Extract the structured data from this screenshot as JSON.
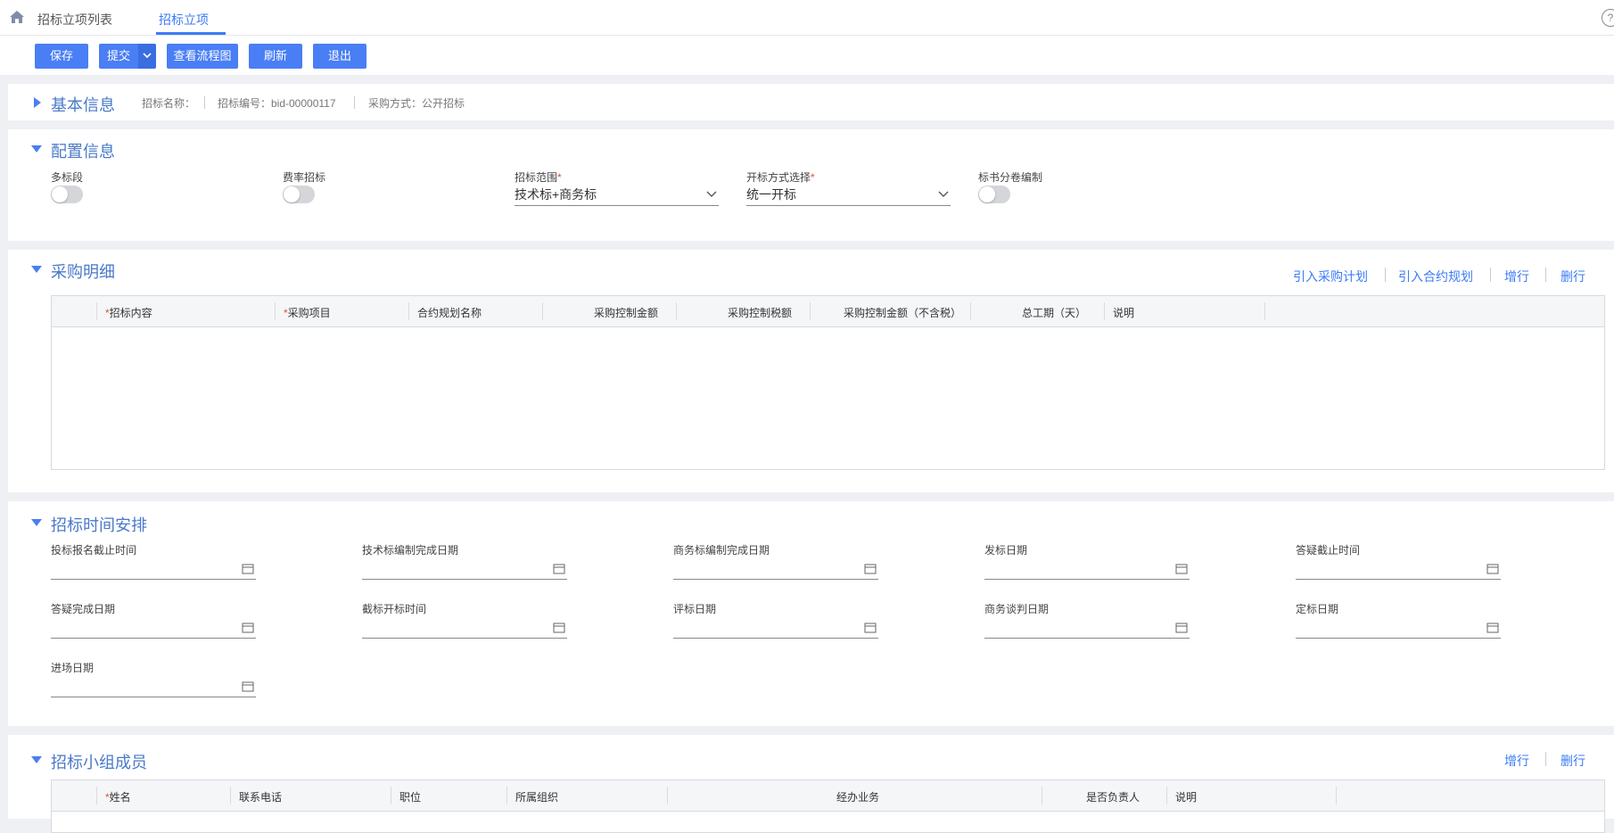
{
  "tabs": {
    "list_label": "招标立项列表",
    "active_label": "招标立项"
  },
  "toolbar": {
    "save_label": "保存",
    "submit_label": "提交",
    "flow_label": "查看流程图",
    "refresh_label": "刷新",
    "exit_label": "退出"
  },
  "basic": {
    "title": "基本信息",
    "bid_name": "招标名称：",
    "bid_no": "招标编号：bid-00000117",
    "purchase_method": "采购方式：公开招标"
  },
  "config": {
    "title": "配置信息",
    "multi_section_label": "多标段",
    "rate_bid_label": "费率招标",
    "scope_label": "招标范围",
    "scope_value": "技术标+商务标",
    "opening_label": "开标方式选择",
    "opening_value": "统一开标",
    "volume_label": "标书分卷编制",
    "required_mark": "*"
  },
  "purchase": {
    "title": "采购明细",
    "import_plan": "引入采购计划",
    "import_contract": "引入合约规划",
    "add_row": "增行",
    "del_row": "删行",
    "columns": [
      "招标内容",
      "采购项目",
      "合约规划名称",
      "采购控制金额",
      "采购控制税额",
      "采购控制金额（不含税）",
      "总工期（天）",
      "说明"
    ]
  },
  "schedule": {
    "title": "招标时间安排",
    "fields": [
      "投标报名截止时间",
      "技术标编制完成日期",
      "商务标编制完成日期",
      "发标日期",
      "答疑截止时间",
      "答疑完成日期",
      "截标开标时间",
      "评标日期",
      "商务谈判日期",
      "定标日期",
      "进场日期"
    ]
  },
  "team": {
    "title": "招标小组成员",
    "add_row": "增行",
    "del_row": "删行",
    "columns": [
      "姓名",
      "联系电话",
      "职位",
      "所属组织",
      "经办业务",
      "是否负责人",
      "说明"
    ]
  },
  "colors": {
    "accent": "#4a7ef5",
    "section_title": "#4a79c9",
    "required": "#e74c3c"
  }
}
